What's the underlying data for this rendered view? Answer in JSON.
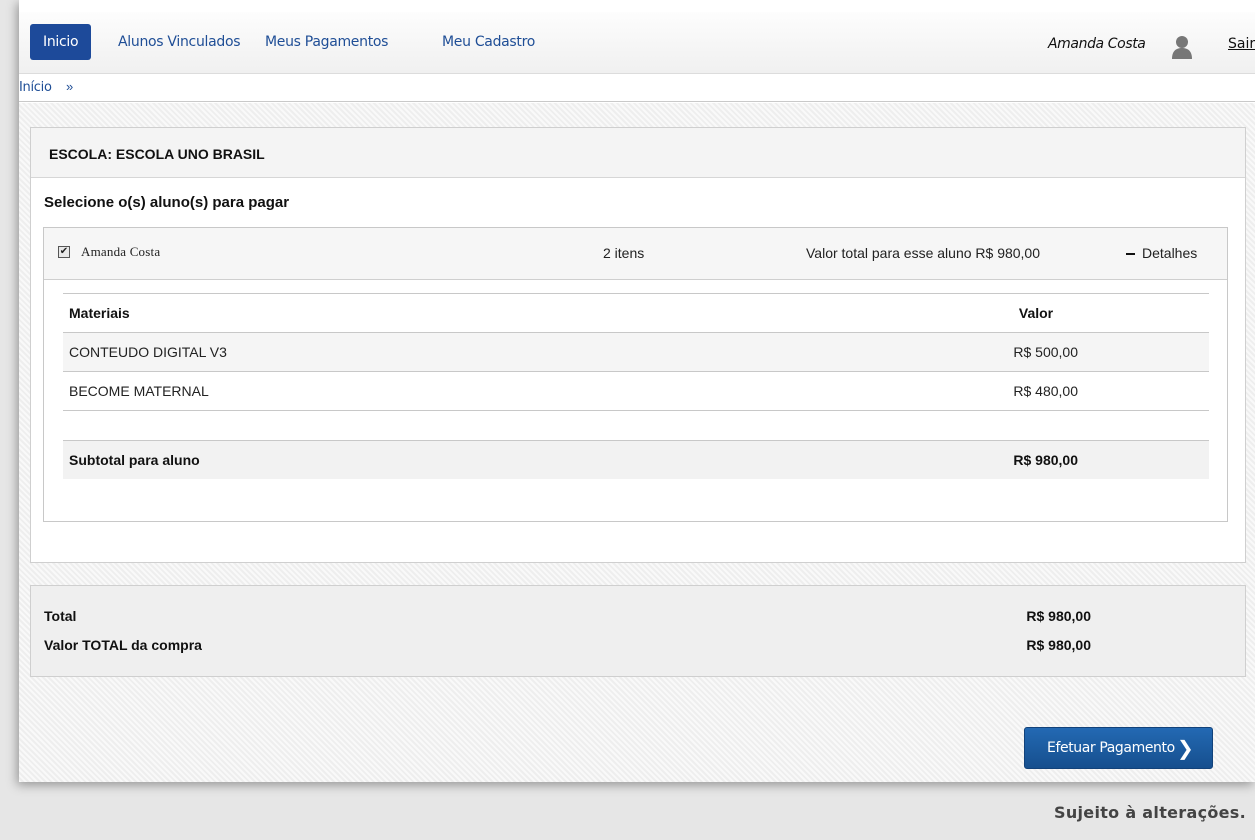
{
  "nav": {
    "items": [
      {
        "label": "Inicio",
        "active": true
      },
      {
        "label": "Alunos Vinculados",
        "active": false
      },
      {
        "label": "Meus Pagamentos",
        "active": false
      },
      {
        "label": "Meu Cadastro",
        "active": false
      }
    ],
    "user_name": "Amanda Costa",
    "user_icon": "user-icon",
    "logout_label": "Sair"
  },
  "breadcrumb": {
    "link": "Início",
    "separator": "»"
  },
  "school": {
    "title": "ESCOLA: ESCOLA UNO BRASIL",
    "select_title": "Selecione o(s) aluno(s) para pagar"
  },
  "student": {
    "checked": true,
    "name": "Amanda Costa",
    "items_count": "2 itens",
    "total_text": "Valor total para esse aluno R$ 980,00",
    "details_label": "Detalhes",
    "details_icon": "minus-icon"
  },
  "materials": {
    "header_name": "Materiais",
    "header_value": "Valor",
    "rows": [
      {
        "name": "CONTEUDO DIGITAL V3",
        "value": "R$ 500,00"
      },
      {
        "name": "BECOME MATERNAL",
        "value": "R$ 480,00"
      }
    ],
    "subtotal_label": "Subtotal para aluno",
    "subtotal_value": "R$ 980,00"
  },
  "totals": {
    "total_label": "Total",
    "total_value": "R$ 980,00",
    "grand_label": "Valor TOTAL da compra",
    "grand_value": "R$ 980,00"
  },
  "pay_button": {
    "label": "Efetuar Pagamento",
    "icon": "chevron-right-icon"
  },
  "footer_note": "Sujeito à alterações.",
  "colors": {
    "nav_active": "#1d4a9a",
    "link": "#1f4e96",
    "pay_button": "#1a5ca3"
  }
}
